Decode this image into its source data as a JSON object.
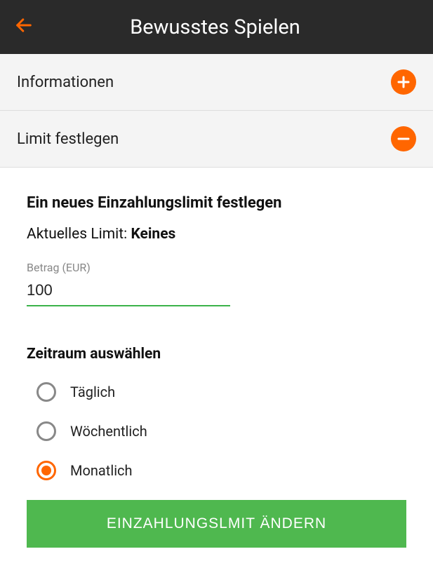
{
  "header": {
    "title": "Bewusstes Spielen"
  },
  "accordion": {
    "info_label": "Informationen",
    "limit_label": "Limit festlegen"
  },
  "form": {
    "heading": "Ein neues Einzahlungslimit festlegen",
    "current_limit_prefix": "Aktuelles Limit: ",
    "current_limit_value": "Keines",
    "amount_label": "Betrag (EUR)",
    "amount_value": "100",
    "period_heading": "Zeitraum auswählen",
    "periods": {
      "daily": "Täglich",
      "weekly": "Wöchentlich",
      "monthly": "Monatlich"
    },
    "submit_label": "EINZAHLUNGSLMIT ÄNDERN"
  }
}
